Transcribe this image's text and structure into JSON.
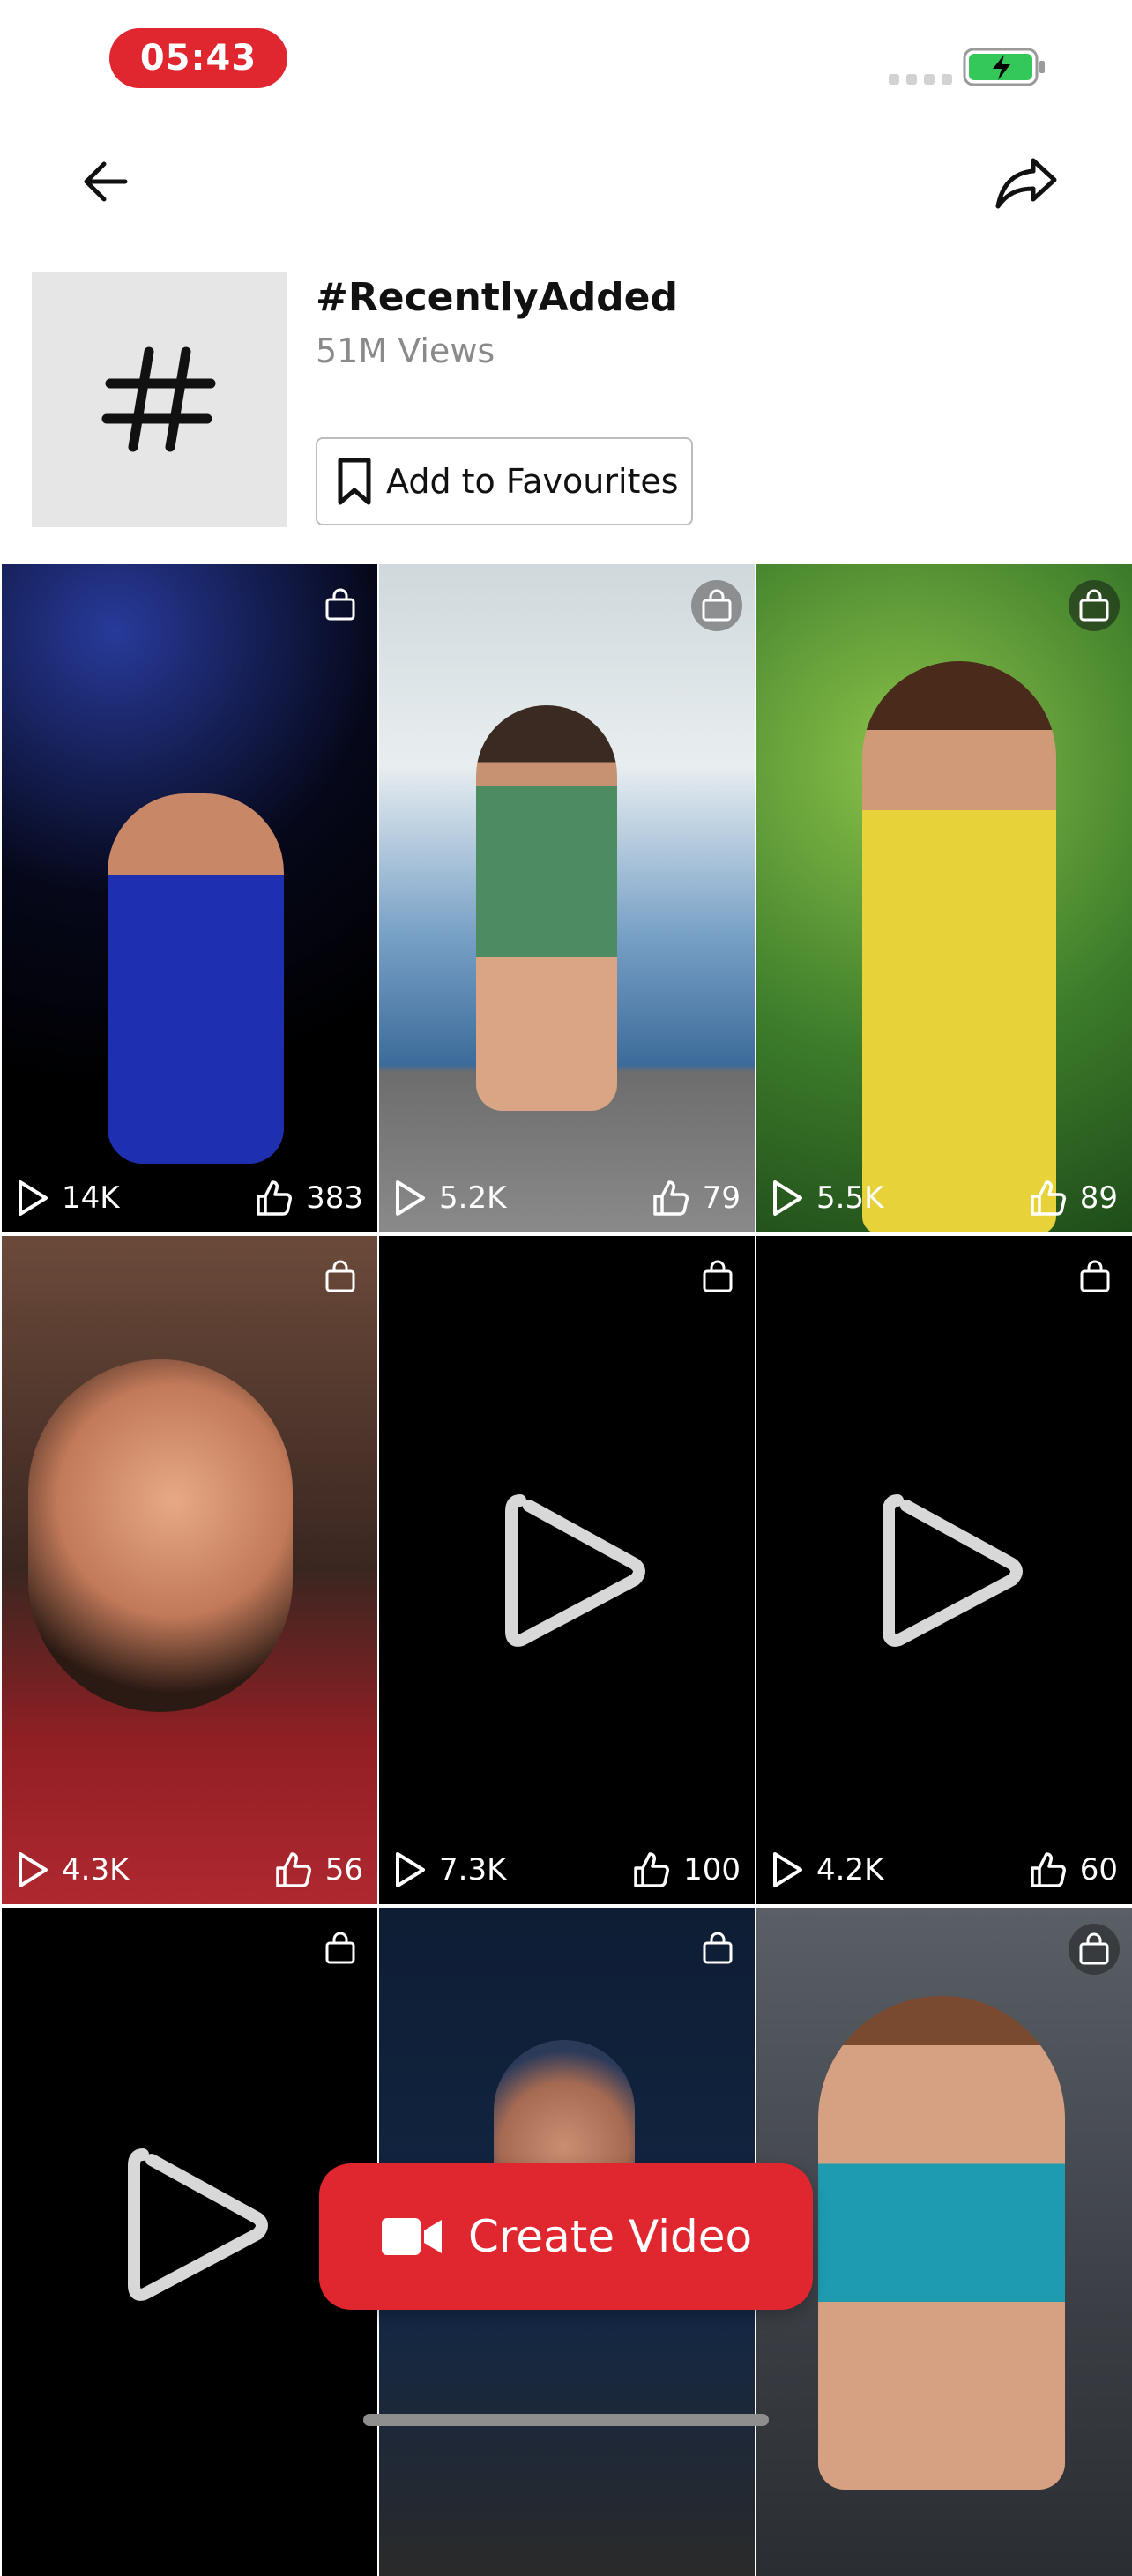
{
  "status_bar": {
    "time": "05:43",
    "battery_color": "#34c759"
  },
  "header": {
    "title": "#RecentlyAdded",
    "views": "51M Views",
    "favourite_label": "Add to Favourites"
  },
  "tiles": [
    {
      "views": "14K",
      "likes": "383"
    },
    {
      "views": "5.2K",
      "likes": "79"
    },
    {
      "views": "5.5K",
      "likes": "89"
    },
    {
      "views": "4.3K",
      "likes": "56"
    },
    {
      "views": "7.3K",
      "likes": "100"
    },
    {
      "views": "4.2K",
      "likes": "60"
    },
    {
      "views": "",
      "likes": ""
    },
    {
      "views": "",
      "likes": ""
    },
    {
      "views": "",
      "likes": ""
    }
  ],
  "fab": {
    "label": "Create Video",
    "color": "#e0262e"
  }
}
